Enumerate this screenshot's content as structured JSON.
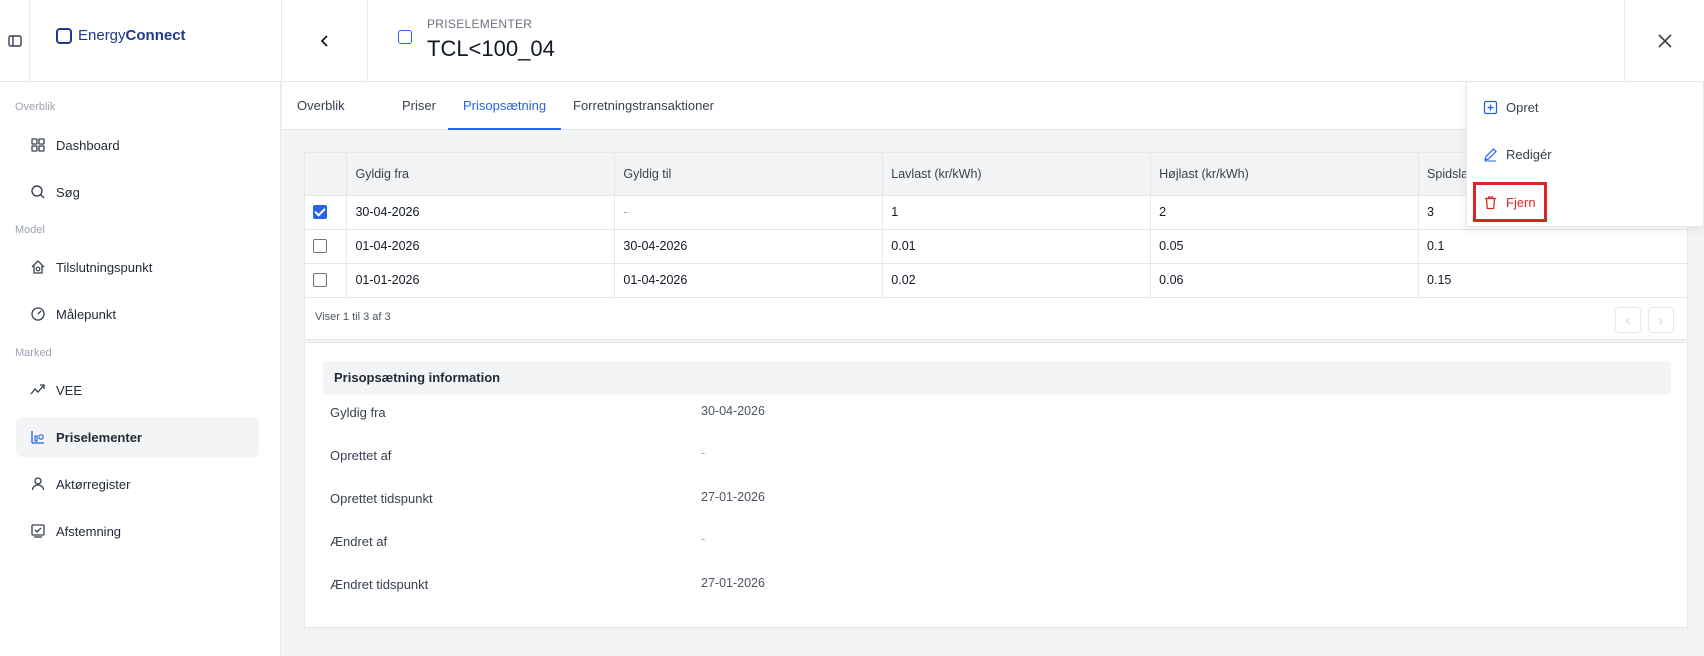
{
  "app": {
    "logo_prefix": "Energy",
    "logo_suffix": "Connect",
    "overline": "PRISELEMENTER",
    "title": "TCL<100_04"
  },
  "sidebar": {
    "sections": [
      {
        "label": "Overblik"
      },
      {
        "label": "Model"
      },
      {
        "label": "Marked"
      }
    ],
    "items": [
      {
        "label": "Dashboard",
        "icon": "grid-icon"
      },
      {
        "label": "Søg",
        "icon": "search-icon"
      },
      {
        "label": "Tilslutningspunkt",
        "icon": "home-plug-icon"
      },
      {
        "label": "Målepunkt",
        "icon": "gauge-icon"
      },
      {
        "label": "VEE",
        "icon": "trend-icon"
      },
      {
        "label": "Priselementer",
        "icon": "price-chart-icon",
        "active": true
      },
      {
        "label": "Aktørregister",
        "icon": "user-icon"
      },
      {
        "label": "Afstemning",
        "icon": "check-monitor-icon"
      }
    ]
  },
  "tabs": [
    {
      "label": "Overblik"
    },
    {
      "label": "Priser"
    },
    {
      "label": "Prisopsætning",
      "active": true
    },
    {
      "label": "Forretningstransaktioner"
    }
  ],
  "table": {
    "headers": [
      "Gyldig fra",
      "Gyldig til",
      "Lavlast (kr/kWh)",
      "Højlast (kr/kWh)",
      "Spidsla"
    ],
    "rows": [
      {
        "checked": true,
        "cells": [
          "30-04-2026",
          "-",
          "1",
          "2",
          "3"
        ]
      },
      {
        "checked": false,
        "cells": [
          "01-04-2026",
          "30-04-2026",
          "0.01",
          "0.05",
          "0.1"
        ]
      },
      {
        "checked": false,
        "cells": [
          "01-01-2026",
          "01-04-2026",
          "0.02",
          "0.06",
          "0.15"
        ]
      }
    ],
    "footer": "Viser 1 til 3 af 3"
  },
  "info": {
    "title": "Prisopsætning information",
    "fields": [
      {
        "label": "Gyldig fra",
        "value": "30-04-2026"
      },
      {
        "label": "Oprettet af",
        "value": "-"
      },
      {
        "label": "Oprettet tidspunkt",
        "value": "27-01-2026"
      },
      {
        "label": "Ændret af",
        "value": "-"
      },
      {
        "label": "Ændret tidspunkt",
        "value": "27-01-2026"
      }
    ]
  },
  "menu": {
    "items": [
      {
        "label": "Opret",
        "icon": "plus-square-icon"
      },
      {
        "label": "Redigér",
        "icon": "pencil-icon"
      },
      {
        "label": "Fjern",
        "icon": "trash-icon"
      }
    ]
  },
  "colors": {
    "accent": "#2563eb",
    "danger": "#dc2626",
    "brand": "#1e3a8a"
  }
}
